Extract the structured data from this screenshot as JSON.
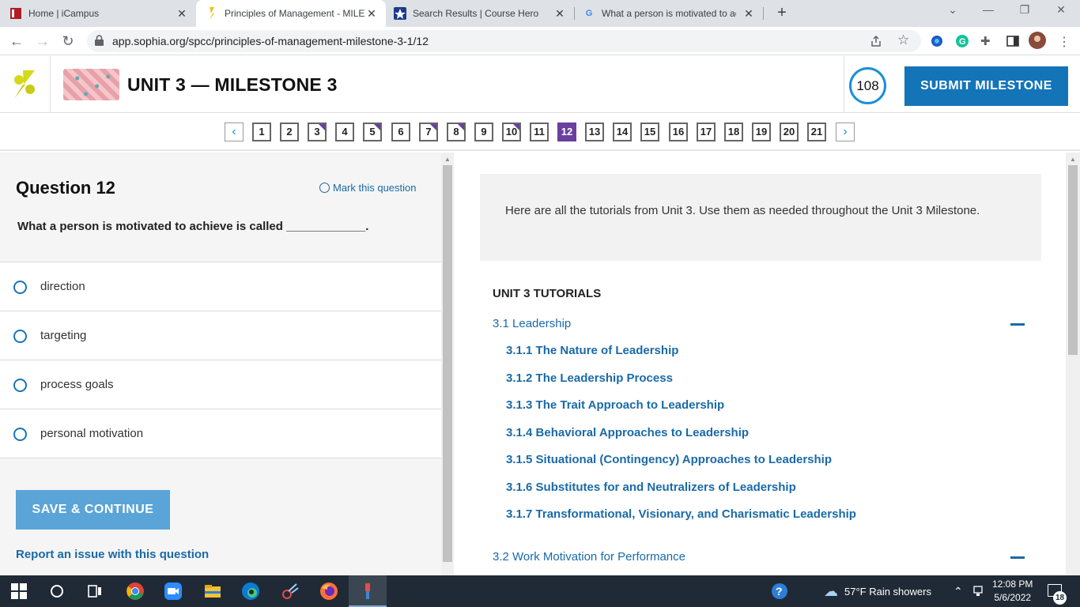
{
  "browser": {
    "tabs": [
      {
        "title": "Home | iCampus"
      },
      {
        "title": "Principles of Management - MILE"
      },
      {
        "title": "Search Results | Course Hero"
      },
      {
        "title": "What a person is motivated to ac"
      }
    ],
    "url": "app.sophia.org/spcc/principles-of-management-milestone-3-1/12"
  },
  "header": {
    "title": "UNIT 3 — MILESTONE 3",
    "score": "108",
    "submit_label": "SUBMIT MILESTONE"
  },
  "question_nav": {
    "numbers": [
      "1",
      "2",
      "3",
      "4",
      "5",
      "6",
      "7",
      "8",
      "9",
      "10",
      "11",
      "12",
      "13",
      "14",
      "15",
      "16",
      "17",
      "18",
      "19",
      "20",
      "21"
    ],
    "current": "12",
    "marked": [
      "3",
      "5",
      "7",
      "8",
      "10"
    ]
  },
  "question": {
    "title": "Question 12",
    "mark_label": "Mark this question",
    "text": "What a person is motivated to achieve is called ____________.",
    "options": [
      "direction",
      "targeting",
      "process goals",
      "personal motivation"
    ],
    "save_label": "SAVE & CONTINUE",
    "report_label": "Report an issue with this question"
  },
  "tutorials": {
    "intro": "Here are all the tutorials from Unit 3. Use them as needed throughout the Unit 3 Milestone.",
    "heading": "UNIT 3 TUTORIALS",
    "section1": "3.1 Leadership",
    "items": [
      "3.1.1 The Nature of Leadership",
      "3.1.2 The Leadership Process",
      "3.1.3 The Trait Approach to Leadership",
      "3.1.4 Behavioral Approaches to Leadership",
      "3.1.5 Situational (Contingency) Approaches to Leadership",
      "3.1.6 Substitutes for and Neutralizers of Leadership",
      "3.1.7 Transformational, Visionary, and Charismatic Leadership"
    ],
    "section2": "3.2 Work Motivation for Performance"
  },
  "taskbar": {
    "weather": "57°F  Rain showers",
    "time": "12:08 PM",
    "date": "5/6/2022",
    "notifications": "18"
  },
  "colors": {
    "accent_blue": "#1474b8",
    "purple": "#6b3fa0",
    "link": "#1a6aa8"
  }
}
